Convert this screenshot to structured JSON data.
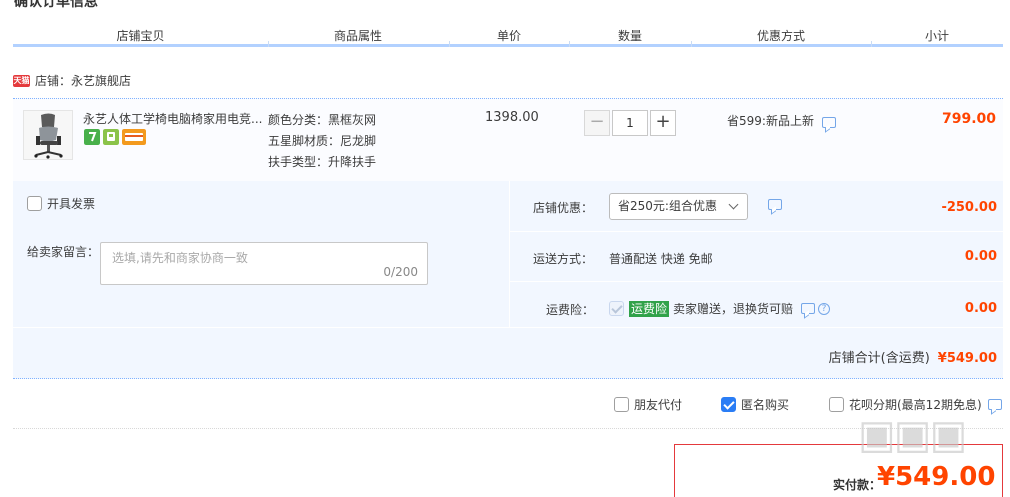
{
  "section_title": "确认订单信息",
  "columns": [
    "店铺宝贝",
    "商品属性",
    "单价",
    "数量",
    "优惠方式",
    "小计"
  ],
  "shop": {
    "badge": "天猫",
    "label": "店铺：永艺旗舰店"
  },
  "item": {
    "title": "永艺人体工学椅电脑椅家用电竞...",
    "attributes": [
      "颜色分类：黑框灰网",
      "五星脚材质：尼龙脚",
      "扶手类型：升降扶手"
    ],
    "unit_price": "1398.00",
    "quantity": "1",
    "qty_minus": "−",
    "qty_plus": "+",
    "promo": "省599:新品上新",
    "subtotal": "799.00"
  },
  "invoice_label": "开具发票",
  "message": {
    "label": "给卖家留言：",
    "placeholder": "选填,请先和商家协商一致",
    "counter": "0/200"
  },
  "shop_discount": {
    "label": "店铺优惠：",
    "selected": "省250元:组合优惠",
    "amount": "-250.00"
  },
  "shipping": {
    "label": "运送方式：",
    "value": "普通配送 快递 免邮",
    "amount": "0.00"
  },
  "insurance": {
    "label": "运费险：",
    "badge": "运费险",
    "text": "卖家赠送，退换货可赔",
    "help": "?",
    "amount": "0.00"
  },
  "shop_total": {
    "label": "店铺合计(含运费)",
    "value": "¥549.00"
  },
  "pay_options": [
    {
      "label": "朋友代付",
      "checked": false
    },
    {
      "label": "匿名购买",
      "checked": true
    },
    {
      "label": "花呗分期(最高12期免息)",
      "checked": false
    }
  ],
  "final": {
    "label": "实付款：",
    "value": "¥549.00"
  },
  "colors": {
    "accent_price": "#ff4400",
    "header_border": "#b2d1ff",
    "panel_bg": "#f2f7ff",
    "insurance_green": "#31a24a",
    "checkbox_blue": "#2a7df5"
  }
}
